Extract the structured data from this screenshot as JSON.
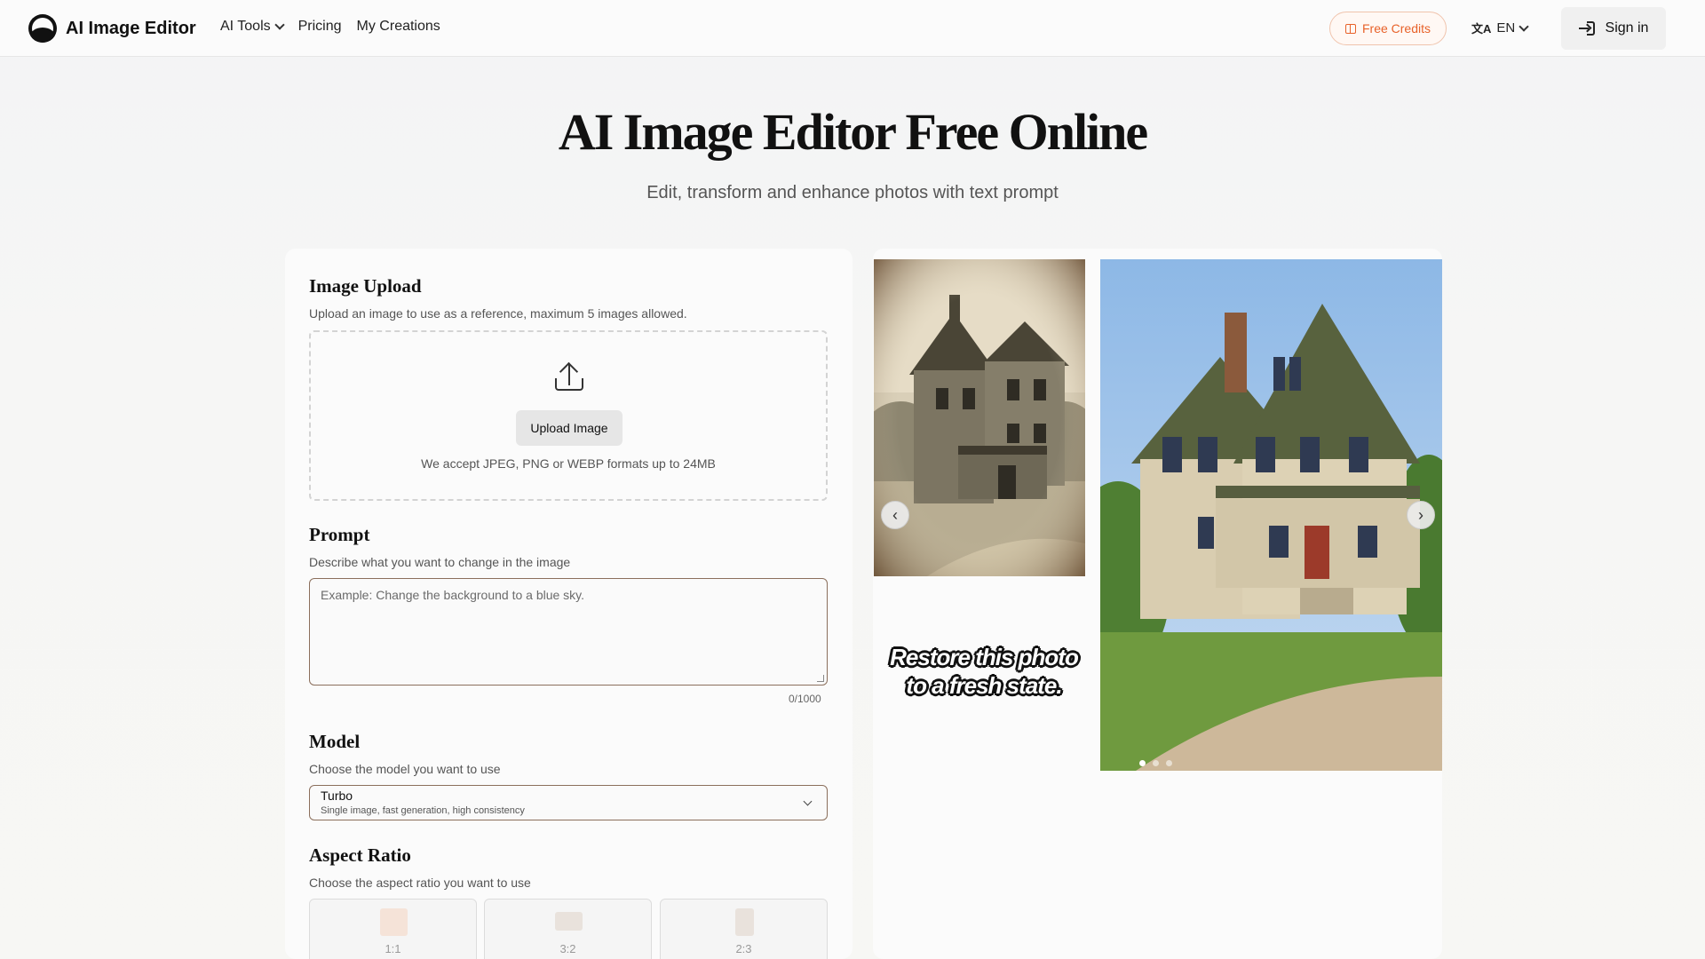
{
  "brand": {
    "name": "AI Image Editor"
  },
  "nav": {
    "links": [
      {
        "label": "AI Tools",
        "has_dropdown": true
      },
      {
        "label": "Pricing",
        "has_dropdown": false
      },
      {
        "label": "My Creations",
        "has_dropdown": false
      }
    ],
    "credits_label": "Free Credits",
    "language": "EN",
    "signin_label": "Sign in"
  },
  "hero": {
    "title": "AI Image Editor Free Online",
    "subtitle": "Edit, transform and enhance photos with text prompt"
  },
  "form": {
    "upload": {
      "title": "Image Upload",
      "description": "Upload an image to use as a reference, maximum 5 images allowed.",
      "button_label": "Upload Image",
      "note": "We accept JPEG, PNG or WEBP formats up to 24MB"
    },
    "prompt": {
      "title": "Prompt",
      "description": "Describe what you want to change in the image",
      "placeholder": "Example: Change the background to a blue sky.",
      "value": "",
      "counter": "0/1000"
    },
    "model": {
      "title": "Model",
      "description": "Choose the model you want to use",
      "selected_name": "Turbo",
      "selected_description": "Single image, fast generation, high consistency"
    },
    "aspect_ratio": {
      "title": "Aspect Ratio",
      "description": "Choose the aspect ratio you want to use",
      "options": [
        "1:1",
        "3:2",
        "2:3"
      ]
    }
  },
  "showcase": {
    "caption_line1": "Restore this photo",
    "caption_line2": "to a fresh state.",
    "prev_label": "‹",
    "next_label": "›",
    "slide_count": 3,
    "active_slide": 1
  },
  "colors": {
    "accent": "#e8622a",
    "border_brown": "#8b6f5c"
  }
}
